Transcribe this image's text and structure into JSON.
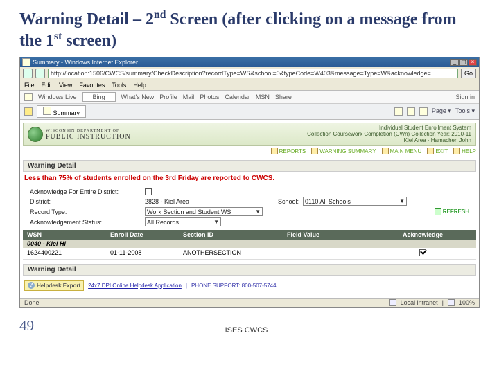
{
  "slide": {
    "title_a": "Warning Detail – 2",
    "title_b": " Screen (after clicking on a message from the 1",
    "title_c": " screen)",
    "sup1": "nd",
    "sup2": "st",
    "page_number": "49",
    "footer": "ISES CWCS"
  },
  "ie": {
    "window_title": "Summary - Windows Internet Explorer",
    "url": "http://location:1506/CWCS/summary/CheckDescription?recordType=WS&school=0&typeCode=W403&message=Type=W&acknowledge=",
    "go": "Go",
    "menus": [
      "File",
      "Edit",
      "View",
      "Favorites",
      "Tools",
      "Help"
    ],
    "wl_label": "Windows Live",
    "bing_placeholder": "Bing",
    "wl_items": [
      "What's New",
      "Profile",
      "Mail",
      "Photos",
      "Calendar",
      "MSN",
      "Share"
    ],
    "signin": "Sign in",
    "fav_star": "★",
    "tab_label": "Summary",
    "fav_right": [
      "Page ▾",
      "Tools ▾"
    ],
    "status_left": "Done",
    "status_intranet": "Local intranet",
    "status_zoom": "100%"
  },
  "app": {
    "dpi_line1": "WISCONSIN DEPARTMENT OF",
    "dpi_line2": "PUBLIC INSTRUCTION",
    "sys_line1": "Individual Student Enrollment System",
    "sys_line2": "Collection Coursework Completion (CWn)    Collection Year: 2010-11",
    "sys_line3": "Kiel Area · Hamacher, John",
    "section_warning_detail": "Warning Detail",
    "toolbar": {
      "reports": "REPORTS",
      "warning_summary": "WARNING SUMMARY",
      "main_menu": "MAIN MENU",
      "exit": "EXIT",
      "help": "HELP"
    },
    "warning_msg": "Less than 75% of students enrolled on the 3rd Friday are reported to CWCS.",
    "form": {
      "ack_label": "Acknowledge For Entire District:",
      "district_label": "District:",
      "district_value": "2828 - Kiel Area",
      "school_label": "School:",
      "school_value": "0110 All Schools",
      "record_label": "Record Type:",
      "record_value": "Work Section and Student WS",
      "ack_status_label": "Acknowledgement Status:",
      "ack_status_value": "All Records",
      "refresh": "REFRESH"
    },
    "table": {
      "headers": [
        "WSN",
        "Enroll Date",
        "Section ID",
        "Field Value",
        "Acknowledge"
      ],
      "group_row": "0040 - Kiel Hi",
      "row": {
        "wsn": "1624400221",
        "enroll": "01-11-2008",
        "section": "ANOTHERSECTION",
        "field": "",
        "ack_checked": true
      }
    },
    "helpdesk": {
      "badge": "Helpdesk Export",
      "link": "24x7 DPI Online Helpdesk Application",
      "phone": "PHONE SUPPORT: 800-507-5744"
    }
  }
}
